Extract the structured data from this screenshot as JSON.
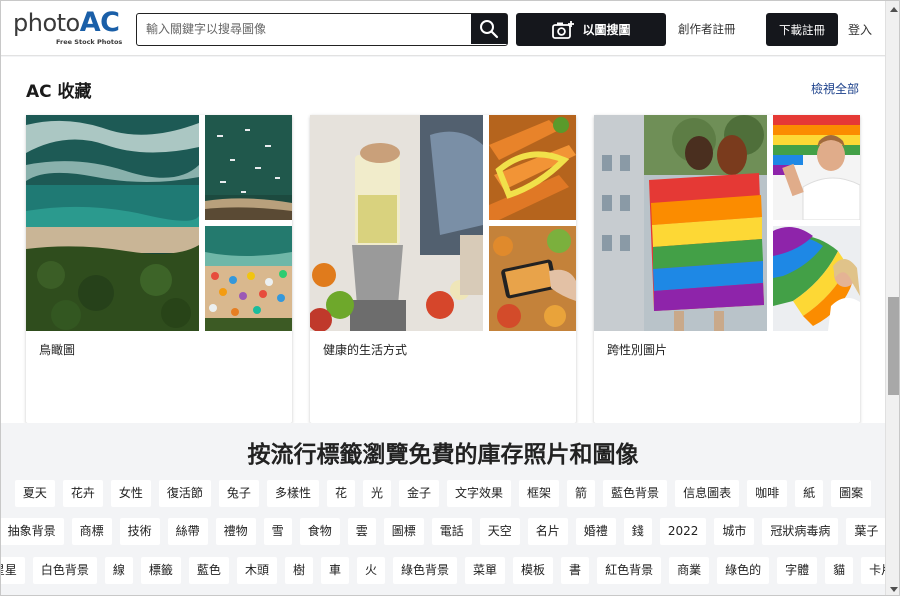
{
  "header": {
    "logo": {
      "text_main": "photo",
      "text_accent": "AC",
      "tagline": "Free Stock Photos"
    },
    "search": {
      "placeholder": "輸入關鍵字以搜尋圖像",
      "value": "",
      "icon": "search-icon"
    },
    "image_search_label": "以圖搜圖",
    "creator_register": "創作者註冊",
    "register": "下載註冊",
    "login": "登入"
  },
  "collections": {
    "title": "AC 收藏",
    "view_all": "檢視全部",
    "cards": [
      {
        "label": "鳥瞰圖"
      },
      {
        "label": "健康的生活方式"
      },
      {
        "label": "跨性別圖片"
      }
    ]
  },
  "tags": {
    "title": "按流行標籤瀏覽免費的庫存照片和圖像",
    "rows": [
      [
        "夏天",
        "花卉",
        "女性",
        "復活節",
        "兔子",
        "多樣性",
        "花",
        "光",
        "金子",
        "文字效果",
        "框架",
        "箭",
        "藍色背景",
        "信息圖表",
        "咖啡",
        "紙",
        "圖案"
      ],
      [
        "抽象背景",
        "商標",
        "技術",
        "絲帶",
        "禮物",
        "雪",
        "食物",
        "雲",
        "圖標",
        "電話",
        "天空",
        "名片",
        "婚禮",
        "錢",
        "2022",
        "城市",
        "冠狀病毒病",
        "葉子"
      ],
      [
        "星星",
        "白色背景",
        "線",
        "標籤",
        "藍色",
        "木頭",
        "樹",
        "車",
        "火",
        "綠色背景",
        "菜單",
        "模板",
        "書",
        "紅色背景",
        "商業",
        "綠色的",
        "字體",
        "貓",
        "卡片"
      ]
    ]
  },
  "colors": {
    "accent": "#1a5fa8",
    "dark_button": "#15171c",
    "link": "#1a3f8a",
    "page_bg": "#f3f4f6"
  }
}
